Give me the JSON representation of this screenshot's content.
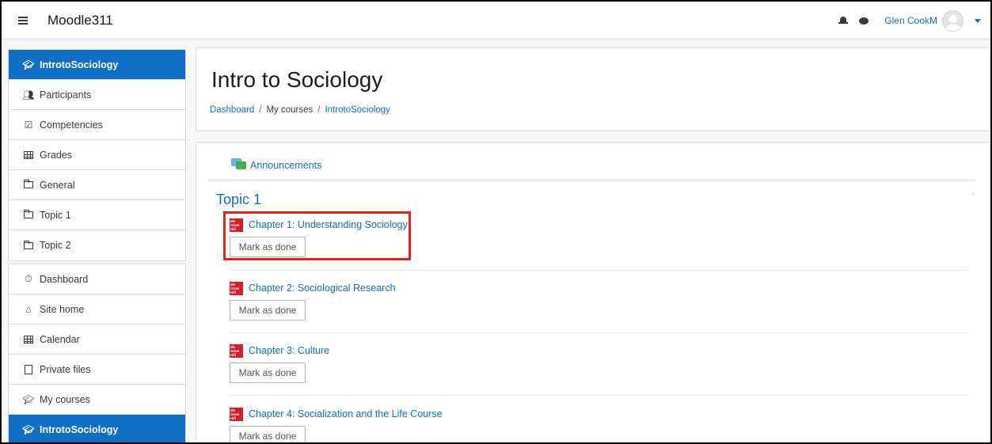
{
  "navbar": {
    "brand": "Moodle311",
    "user_name": "Glen CookM"
  },
  "sidebar": {
    "course_group": [
      {
        "label": "IntrotoSociology",
        "icon": "graduation-cap-icon",
        "active": true
      },
      {
        "label": "Participants",
        "icon": "users-icon"
      },
      {
        "label": "Competencies",
        "icon": "check-square-icon"
      },
      {
        "label": "Grades",
        "icon": "table-icon"
      },
      {
        "label": "General",
        "icon": "folder-icon"
      },
      {
        "label": "Topic 1",
        "icon": "folder-icon"
      },
      {
        "label": "Topic 2",
        "icon": "folder-icon"
      }
    ],
    "site_group": [
      {
        "label": "Dashboard",
        "icon": "tachometer-icon"
      },
      {
        "label": "Site home",
        "icon": "home-icon"
      },
      {
        "label": "Calendar",
        "icon": "calendar-icon"
      },
      {
        "label": "Private files",
        "icon": "file-icon"
      },
      {
        "label": "My courses",
        "icon": "graduation-cap-icon"
      },
      {
        "label": "IntrotoSociology",
        "icon": "graduation-cap-icon",
        "active": true
      }
    ]
  },
  "header": {
    "title": "Intro to Sociology",
    "breadcrumb": [
      "Dashboard",
      "My courses",
      "IntrotoSociology"
    ],
    "breadcrumb_sep": "/"
  },
  "course": {
    "announcements": "Announcements",
    "section_title": "Topic 1",
    "activities": [
      {
        "title": "Chapter 1: Understanding Sociology",
        "button": "Mark as done",
        "highlighted": true
      },
      {
        "title": "Chapter 2: Sociological Research",
        "button": "Mark as done"
      },
      {
        "title": "Chapter 3: Culture",
        "button": "Mark as done"
      },
      {
        "title": "Chapter 4: Socialization and the Life Course",
        "button": "Mark as done"
      }
    ],
    "logo_text": "Mc Graw Hill"
  },
  "colors": {
    "accent": "#0f6fc5",
    "highlight": "#e52421",
    "mcgraw_red": "#d41f26"
  }
}
